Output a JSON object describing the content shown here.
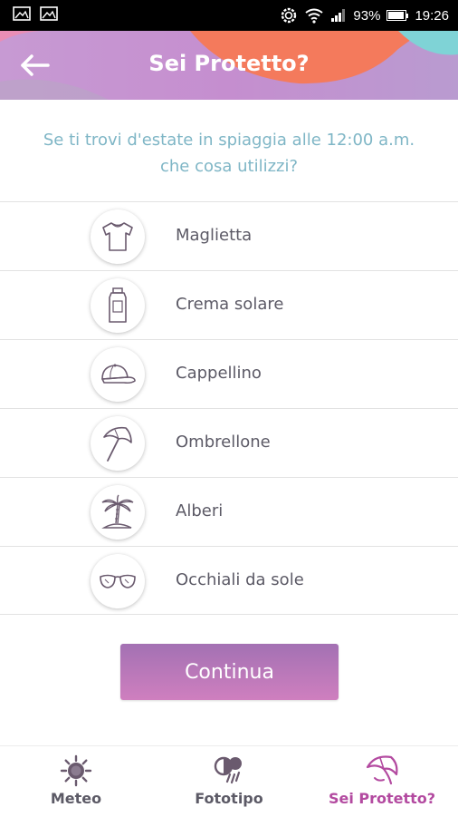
{
  "status_bar": {
    "battery": "93%",
    "battery_level": 0.93,
    "time": "19:26"
  },
  "header": {
    "title": "Sei Protetto?",
    "back_icon": "arrow-left-icon"
  },
  "question": {
    "line1": "Se ti trovi d'estate in spiaggia alle 12:00 a.m.",
    "line2": "che cosa utilizzi?"
  },
  "options": [
    {
      "label": "Maglietta",
      "icon": "tshirt-icon"
    },
    {
      "label": "Crema solare",
      "icon": "sunscreen-icon"
    },
    {
      "label": "Cappellino",
      "icon": "cap-icon"
    },
    {
      "label": "Ombrellone",
      "icon": "beach-umbrella-icon"
    },
    {
      "label": "Alberi",
      "icon": "palm-tree-icon"
    },
    {
      "label": "Occhiali da sole",
      "icon": "sunglasses-icon"
    }
  ],
  "continue_label": "Continua",
  "nav": [
    {
      "label": "Meteo",
      "icon": "sun-icon",
      "active": false
    },
    {
      "label": "Fototipo",
      "icon": "phototype-icon",
      "active": false
    },
    {
      "label": "Sei Protetto?",
      "icon": "umbrella-icon",
      "active": true
    }
  ],
  "colors": {
    "accent": "#b34aa0",
    "button_top": "#a371b3",
    "button_bottom": "#cf7fbf",
    "question_text": "#7fb6c6",
    "header_orange": "#f47a5c",
    "header_teal": "#7fd3d6",
    "icon_stroke": "#6a5a6e"
  }
}
